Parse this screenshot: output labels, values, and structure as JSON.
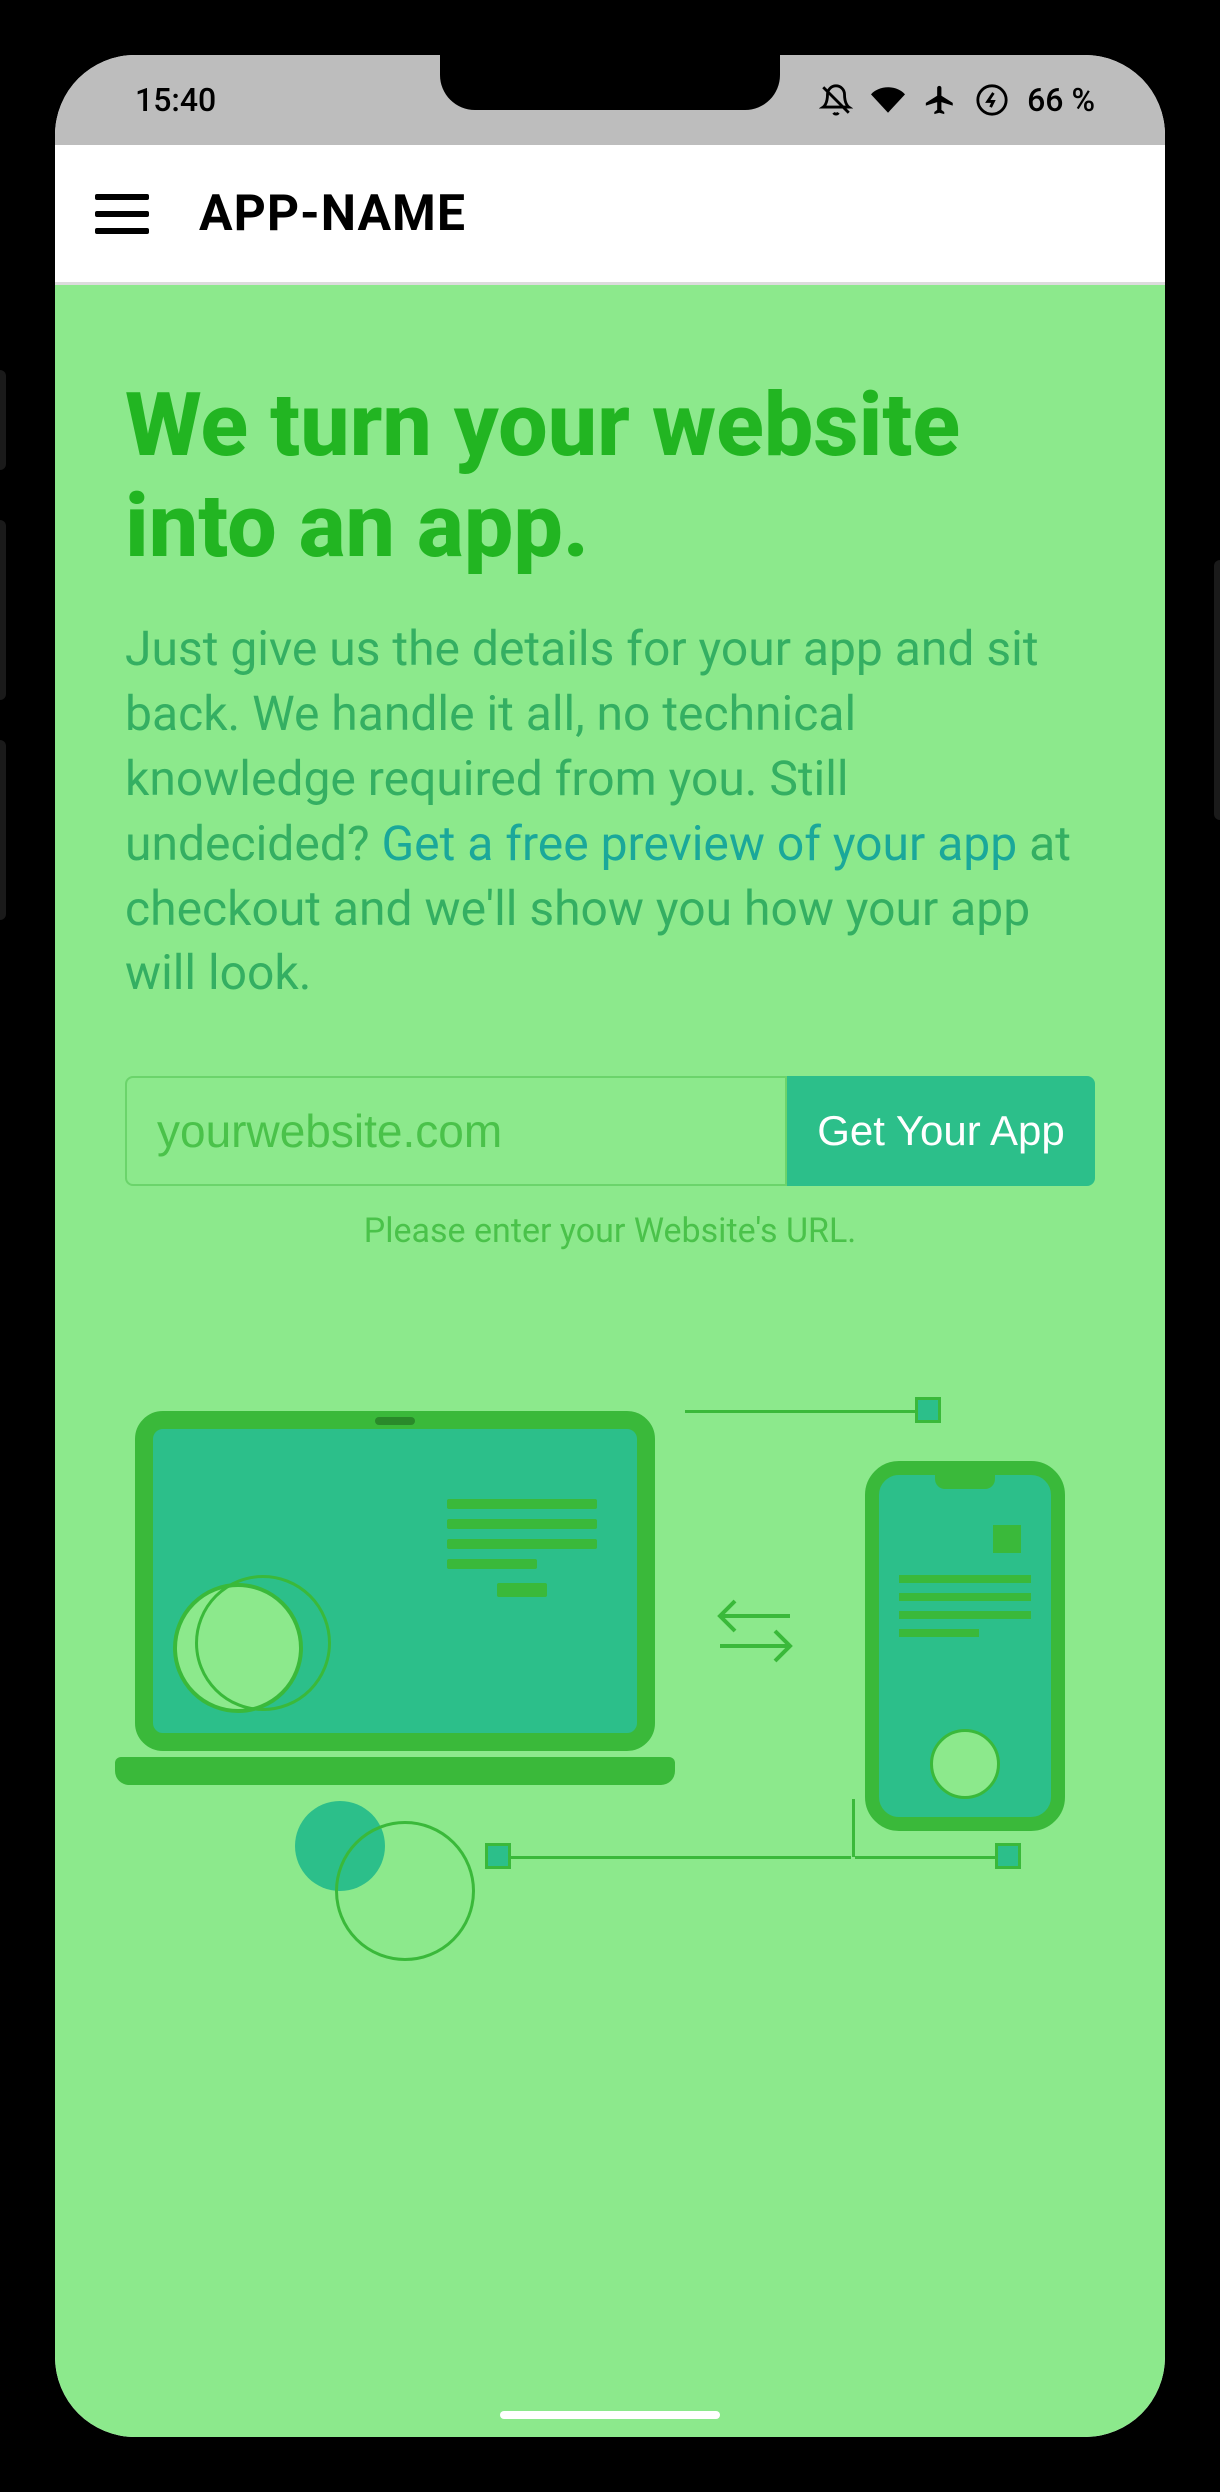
{
  "status": {
    "time": "15:40",
    "battery": "66 %"
  },
  "appbar": {
    "title": "APP-NAME"
  },
  "hero": {
    "headline": "We turn your website into an app.",
    "subtext_before": "Just give us the details for your app and sit back. We handle it all, no technical knowledge required from you. Still undecided? ",
    "subtext_link": "Get a free preview of your app",
    "subtext_after": " at checkout and we'll show you how your app will look."
  },
  "form": {
    "placeholder": "yourwebsite.com",
    "cta": "Get Your App",
    "helper": "Please enter your Website's URL."
  }
}
